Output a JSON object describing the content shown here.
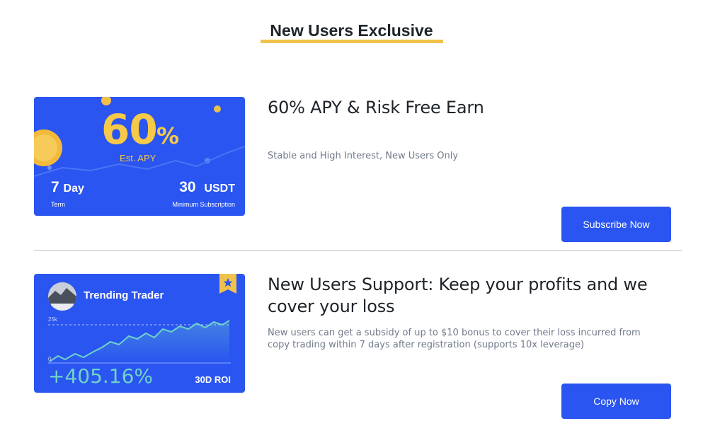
{
  "header": {
    "title": "New Users Exclusive"
  },
  "offers": [
    {
      "image": {
        "apy_number": "60",
        "apy_percent": "%",
        "apy_label": "Est. APY",
        "term_value": "7",
        "term_unit": "Day",
        "term_label": "Term",
        "min_value": "30",
        "min_unit": "USDT",
        "min_label": "Minimum Subscription"
      },
      "title": "60% APY & Risk Free Earn",
      "description": "Stable and High Interest, New Users Only",
      "button": "Subscribe Now"
    },
    {
      "image": {
        "trader_name": "Trending Trader",
        "axis_top": "25k",
        "axis_zero": "0",
        "roi_value": "+405.16%",
        "roi_label": "30D ROI"
      },
      "title": "New Users Support: Keep your profits and we cover your loss",
      "description": "New users can get a subsidy of up to $10 bonus to cover their loss incurred from copy trading within 7 days after registration (supports 10x leverage)",
      "button": "Copy Now"
    }
  ],
  "colors": {
    "accent_blue": "#2a55f0",
    "underline_yellow": "#f0c24b",
    "apy_yellow": "#f7c948",
    "roi_teal": "#6fd3c9"
  },
  "icons": [
    "coin-icon",
    "star-badge-icon",
    "avatar-image"
  ]
}
